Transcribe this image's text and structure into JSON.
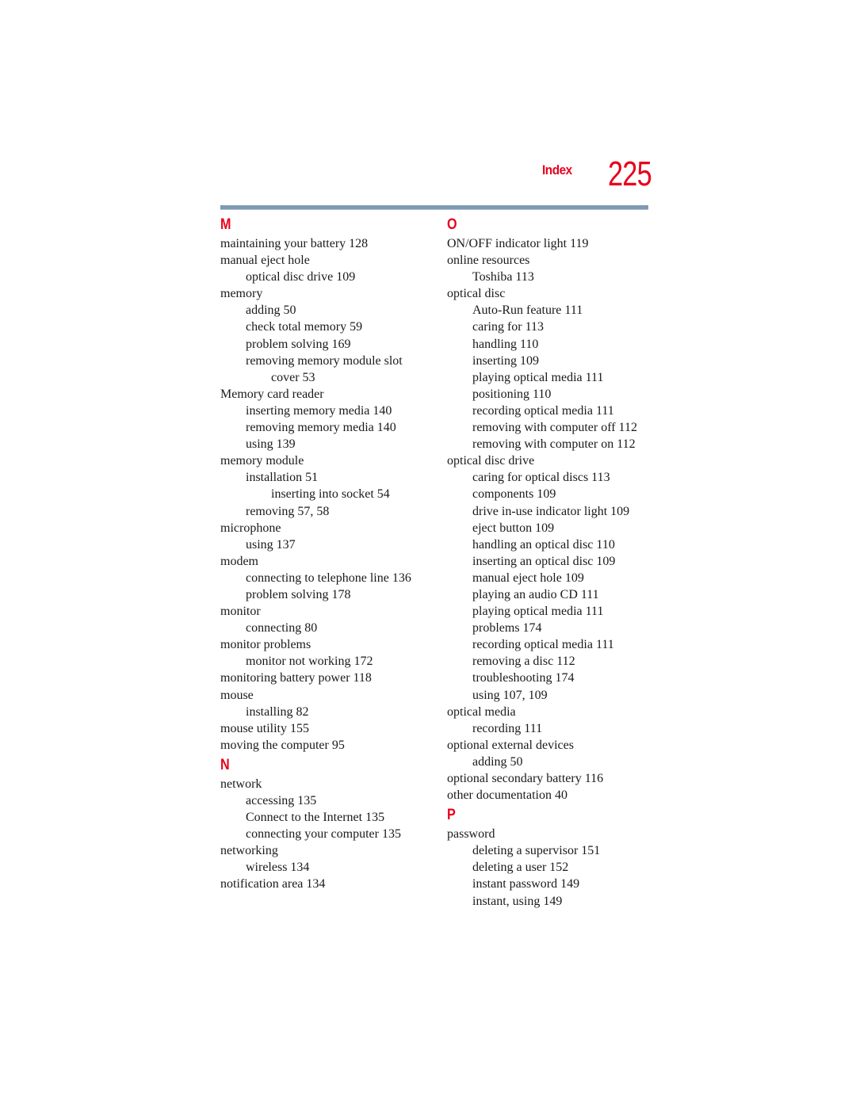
{
  "header": {
    "label": "Index",
    "page_number": "225",
    "accent_color": "#e8001c",
    "rule_color": "#7f9ab2"
  },
  "columns": [
    {
      "sections": [
        {
          "letter": "M",
          "entries": [
            {
              "level": 1,
              "text": "maintaining your battery 128"
            },
            {
              "level": 1,
              "text": "manual eject hole"
            },
            {
              "level": 2,
              "text": "optical disc drive 109"
            },
            {
              "level": 1,
              "text": "memory"
            },
            {
              "level": 2,
              "text": "adding 50"
            },
            {
              "level": 2,
              "text": "check total memory 59"
            },
            {
              "level": 2,
              "text": "problem solving 169"
            },
            {
              "level": 2,
              "text": "removing memory module slot"
            },
            {
              "level": 3,
              "text": "cover 53"
            },
            {
              "level": 1,
              "text": "Memory card reader"
            },
            {
              "level": 2,
              "text": "inserting memory media 140"
            },
            {
              "level": 2,
              "text": "removing memory media 140"
            },
            {
              "level": 2,
              "text": "using 139"
            },
            {
              "level": 1,
              "text": "memory module"
            },
            {
              "level": 2,
              "text": "installation 51"
            },
            {
              "level": 3,
              "text": "inserting into socket 54"
            },
            {
              "level": 2,
              "text": "removing 57, 58"
            },
            {
              "level": 1,
              "text": "microphone"
            },
            {
              "level": 2,
              "text": "using 137"
            },
            {
              "level": 1,
              "text": "modem"
            },
            {
              "level": 2,
              "text": "connecting to telephone line 136"
            },
            {
              "level": 2,
              "text": "problem solving 178"
            },
            {
              "level": 1,
              "text": "monitor"
            },
            {
              "level": 2,
              "text": "connecting 80"
            },
            {
              "level": 1,
              "text": "monitor problems"
            },
            {
              "level": 2,
              "text": "monitor not working 172"
            },
            {
              "level": 1,
              "text": "monitoring battery power 118"
            },
            {
              "level": 1,
              "text": "mouse"
            },
            {
              "level": 2,
              "text": "installing 82"
            },
            {
              "level": 1,
              "text": "mouse utility 155"
            },
            {
              "level": 1,
              "text": "moving the computer 95"
            }
          ]
        },
        {
          "letter": "N",
          "entries": [
            {
              "level": 1,
              "text": "network"
            },
            {
              "level": 2,
              "text": "accessing 135"
            },
            {
              "level": 2,
              "text": "Connect to the Internet 135"
            },
            {
              "level": 2,
              "text": "connecting your computer 135"
            },
            {
              "level": 1,
              "text": "networking"
            },
            {
              "level": 2,
              "text": "wireless 134"
            },
            {
              "level": 1,
              "text": "notification area 134"
            }
          ]
        }
      ]
    },
    {
      "sections": [
        {
          "letter": "O",
          "entries": [
            {
              "level": 1,
              "text": "ON/OFF indicator light 119"
            },
            {
              "level": 1,
              "text": "online resources"
            },
            {
              "level": 2,
              "text": "Toshiba 113"
            },
            {
              "level": 1,
              "text": "optical disc"
            },
            {
              "level": 2,
              "text": "Auto-Run feature 111"
            },
            {
              "level": 2,
              "text": "caring for 113"
            },
            {
              "level": 2,
              "text": "handling 110"
            },
            {
              "level": 2,
              "text": "inserting 109"
            },
            {
              "level": 2,
              "text": "playing optical media 111"
            },
            {
              "level": 2,
              "text": "positioning 110"
            },
            {
              "level": 2,
              "text": "recording optical media 111"
            },
            {
              "level": 2,
              "text": "removing with computer off 112"
            },
            {
              "level": 2,
              "text": "removing with computer on 112"
            },
            {
              "level": 1,
              "text": "optical disc drive"
            },
            {
              "level": 2,
              "text": "caring for optical discs 113"
            },
            {
              "level": 2,
              "text": "components 109"
            },
            {
              "level": 2,
              "text": "drive in-use indicator light 109"
            },
            {
              "level": 2,
              "text": "eject button 109"
            },
            {
              "level": 2,
              "text": "handling an optical disc 110"
            },
            {
              "level": 2,
              "text": "inserting an optical disc 109"
            },
            {
              "level": 2,
              "text": "manual eject hole 109"
            },
            {
              "level": 2,
              "text": "playing an audio CD 111"
            },
            {
              "level": 2,
              "text": "playing optical media 111"
            },
            {
              "level": 2,
              "text": "problems 174"
            },
            {
              "level": 2,
              "text": "recording optical media 111"
            },
            {
              "level": 2,
              "text": "removing a disc 112"
            },
            {
              "level": 2,
              "text": "troubleshooting 174"
            },
            {
              "level": 2,
              "text": "using 107, 109"
            },
            {
              "level": 1,
              "text": "optical media"
            },
            {
              "level": 2,
              "text": "recording 111"
            },
            {
              "level": 1,
              "text": "optional external devices"
            },
            {
              "level": 2,
              "text": "adding 50"
            },
            {
              "level": 1,
              "text": "optional secondary battery 116"
            },
            {
              "level": 1,
              "text": "other documentation 40"
            }
          ]
        },
        {
          "letter": "P",
          "entries": [
            {
              "level": 1,
              "text": "password"
            },
            {
              "level": 2,
              "text": "deleting a supervisor 151"
            },
            {
              "level": 2,
              "text": "deleting a user 152"
            },
            {
              "level": 2,
              "text": "instant password 149"
            },
            {
              "level": 2,
              "text": "instant, using 149"
            }
          ]
        }
      ]
    }
  ]
}
